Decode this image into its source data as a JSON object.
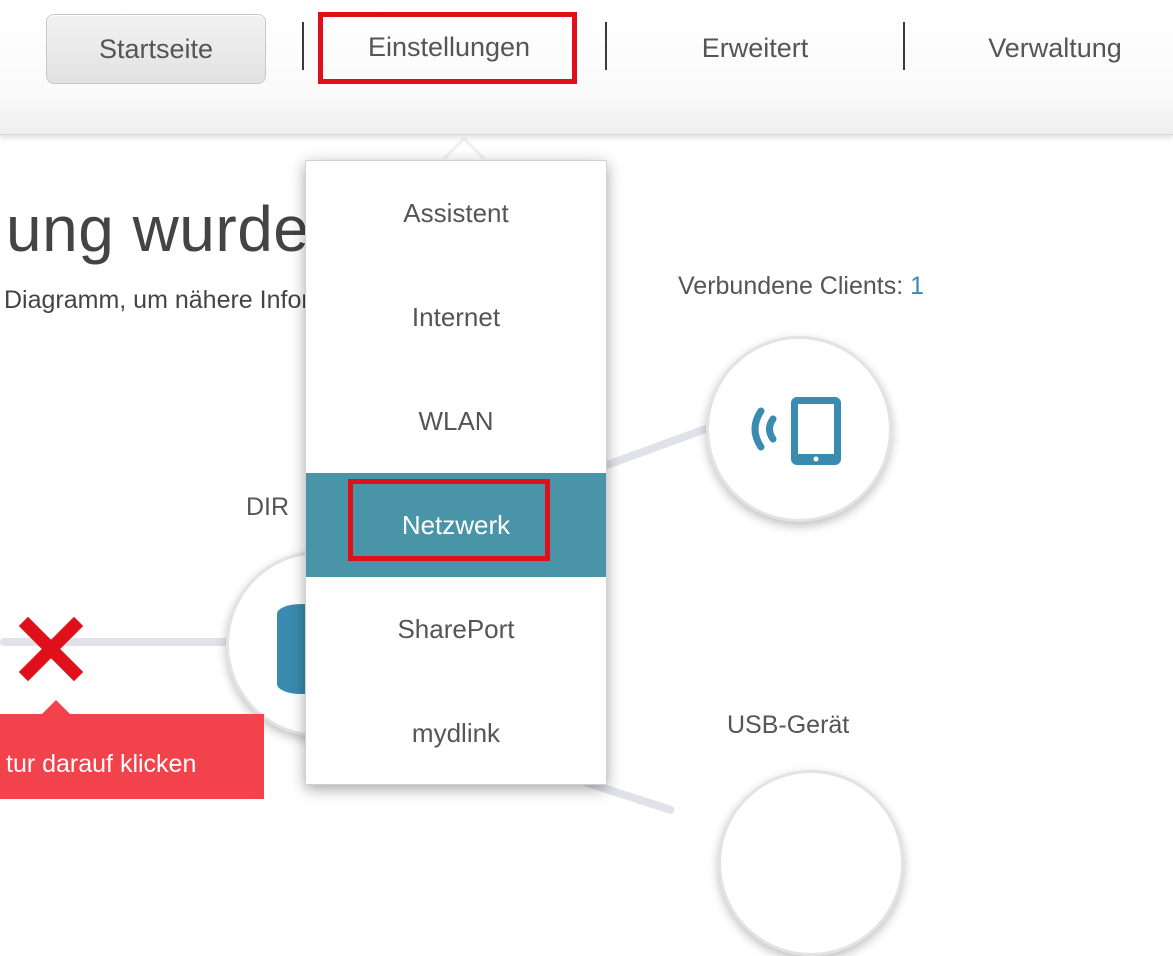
{
  "nav": {
    "items": [
      {
        "label": "Startseite"
      },
      {
        "label": "Einstellungen"
      },
      {
        "label": "Erweitert"
      },
      {
        "label": "Verwaltung"
      }
    ]
  },
  "dropdown": {
    "items": [
      {
        "label": "Assistent"
      },
      {
        "label": "Internet"
      },
      {
        "label": "WLAN"
      },
      {
        "label": "Netzwerk",
        "active": true
      },
      {
        "label": "SharePort"
      },
      {
        "label": "mydlink"
      }
    ]
  },
  "page": {
    "heading": "ung wurde erkannt",
    "hint": "Diagramm, um nähere Informationen zu erhalten."
  },
  "diagram": {
    "clients_label": "Verbundene Clients:",
    "clients_count": "1",
    "router_label": "DIR",
    "usb_label": "USB-Gerät"
  },
  "tooltip": {
    "text": "tur darauf klicken"
  },
  "colors": {
    "accent": "#4a94a8",
    "highlight": "#e0101a",
    "error": "#e0101a",
    "tooltip_bg": "#f2424b",
    "icon": "#3a8bb0"
  },
  "icons": {
    "clients": "wireless-tablet-icon",
    "router": "router-icon",
    "error": "close-x-icon"
  }
}
